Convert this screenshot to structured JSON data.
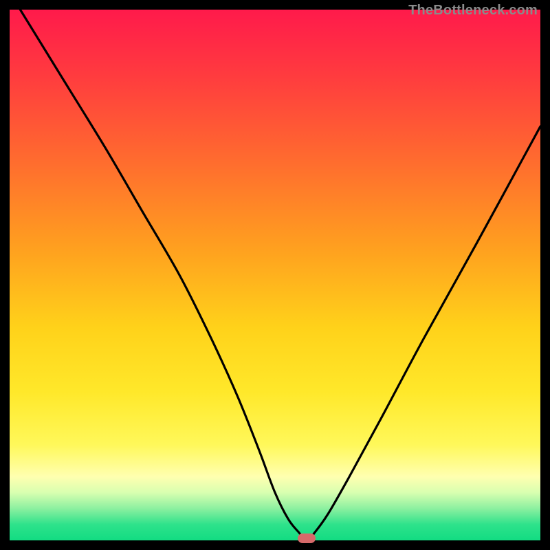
{
  "watermark": "TheBottleneck.com",
  "colors": {
    "frame": "#000000",
    "curve": "#000000",
    "marker": "#d66a6a",
    "gradient_stops": [
      "#ff1a4b",
      "#ff3a3f",
      "#ff6a2f",
      "#ffa01f",
      "#ffd21a",
      "#ffe82a",
      "#fff85a",
      "#ffffb0",
      "#d8ffb0",
      "#8cf0a0",
      "#2ee28b",
      "#12dc82"
    ]
  },
  "chart_data": {
    "type": "line",
    "title": "",
    "xlabel": "",
    "ylabel": "",
    "xlim": [
      0,
      100
    ],
    "ylim": [
      0,
      100
    ],
    "series": [
      {
        "name": "bottleneck-curve",
        "x": [
          2,
          10,
          18,
          25,
          32,
          38,
          43,
          47,
          50,
          52.5,
          54.5,
          56,
          57.5,
          60,
          64,
          70,
          78,
          88,
          100
        ],
        "y": [
          100,
          87,
          74,
          62,
          50,
          38,
          27,
          17,
          9,
          4,
          1.5,
          0,
          1.5,
          5,
          12,
          23,
          38,
          56,
          78
        ]
      }
    ],
    "annotations": [
      {
        "name": "optimal-marker",
        "x": 56,
        "y": 0
      }
    ]
  }
}
